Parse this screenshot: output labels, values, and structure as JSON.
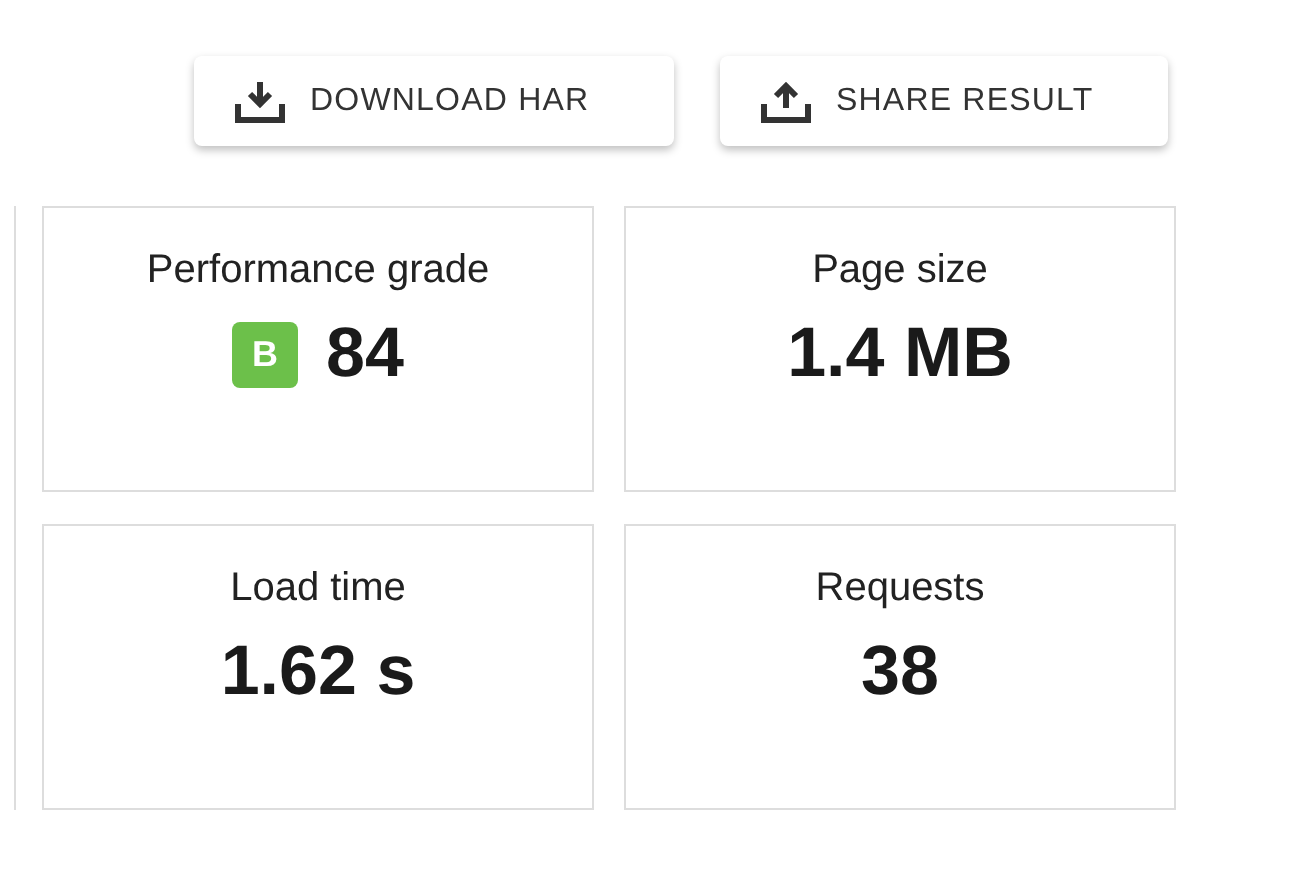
{
  "actions": [
    {
      "kind": "download",
      "label": "DOWNLOAD HAR"
    },
    {
      "kind": "share",
      "label": "SHARE RESULT"
    }
  ],
  "metrics": [
    {
      "label": "Performance grade",
      "value": "84",
      "grade": {
        "letter": "B",
        "color": "#6cc04a"
      }
    },
    {
      "label": "Page size",
      "value": "1.4 MB"
    },
    {
      "label": "Load time",
      "value": "1.62 s"
    },
    {
      "label": "Requests",
      "value": "38"
    }
  ]
}
